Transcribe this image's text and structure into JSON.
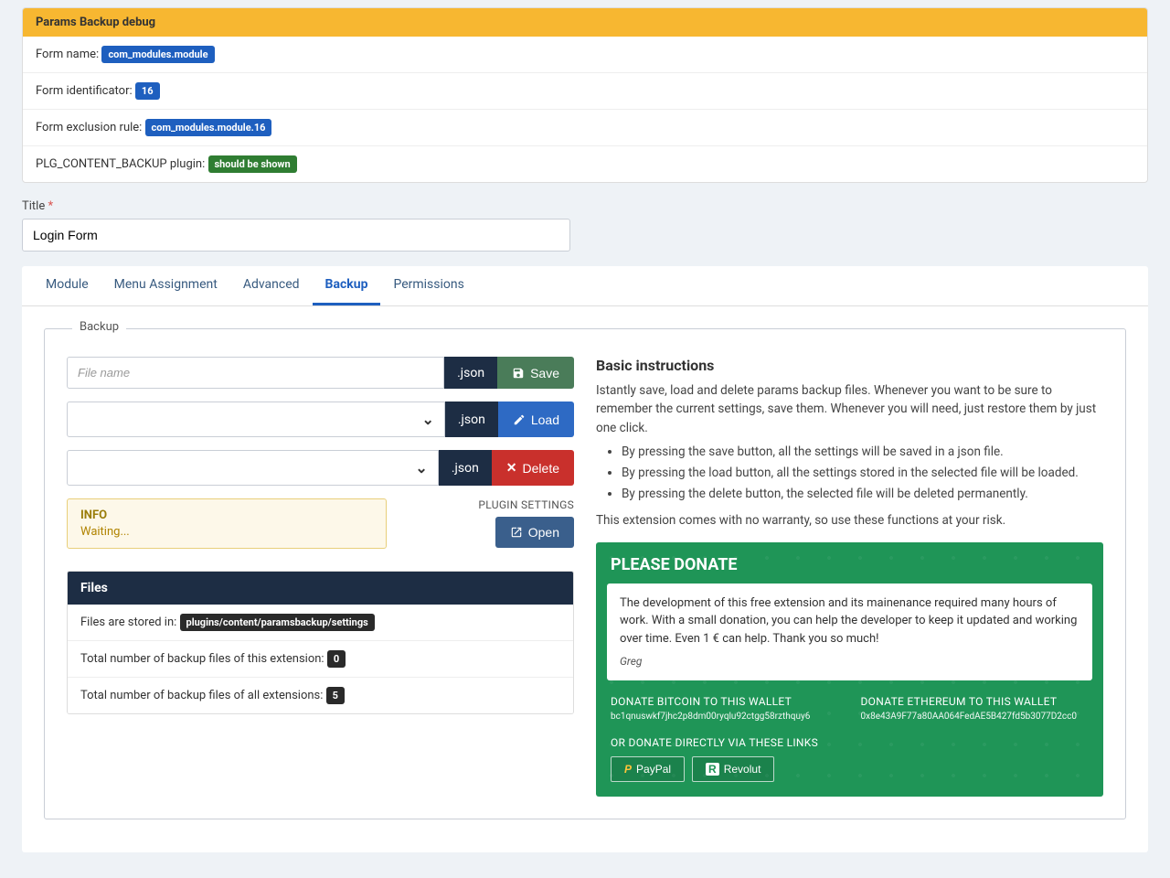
{
  "debug": {
    "header": "Params Backup debug",
    "form_name_label": "Form name:",
    "form_name_value": "com_modules.module",
    "form_id_label": "Form identificator:",
    "form_id_value": "16",
    "exclusion_label": "Form exclusion rule:",
    "exclusion_value": "com_modules.module.16",
    "plugin_label": "PLG_CONTENT_BACKUP plugin:",
    "plugin_value": "should be shown"
  },
  "title": {
    "label": "Title",
    "required": "*",
    "value": "Login Form"
  },
  "tabs": {
    "module": "Module",
    "menu": "Menu Assignment",
    "advanced": "Advanced",
    "backup": "Backup",
    "permissions": "Permissions"
  },
  "backup": {
    "legend": "Backup",
    "filename_placeholder": "File name",
    "ext": ".json",
    "save": "Save",
    "load": "Load",
    "delete": "Delete",
    "info_title": "INFO",
    "info_msg": "Waiting...",
    "settings_label": "PLUGIN SETTINGS",
    "open": "Open",
    "files_header": "Files",
    "files_stored_label": "Files are stored in:",
    "files_stored_path": "plugins/content/paramsbackup/settings",
    "files_this_label": "Total number of backup files of this extension:",
    "files_this_count": "0",
    "files_all_label": "Total number of backup files of all extensions:",
    "files_all_count": "5"
  },
  "instructions": {
    "heading": "Basic instructions",
    "p1": "Istantly save, load and delete params backup files. Whenever you want to be sure to remember the current settings, save them. Whenever you will need, just restore them by just one click.",
    "li1": "By pressing the save button, all the settings will be saved in a json file.",
    "li2": "By pressing the load button, all the settings stored in the selected file will be loaded.",
    "li3": "By pressing the delete button, the selected file will be deleted permanently.",
    "p2": "This extension comes with no warranty, so use these functions at your risk."
  },
  "donate": {
    "title": "PLEASE DONATE",
    "body": "The development of this free extension and its mainenance required many hours of work. With a small donation, you can help the developer to keep it updated and working over time. Even 1 € can help. Thank you so much!",
    "signature": "Greg",
    "btc_title": "DONATE BITCOIN TO THIS WALLET",
    "btc_addr": "bc1qnuswkf7jhc2p8dm00ryqlu92ctgg58rzthquy6",
    "eth_title": "DONATE ETHEREUM TO THIS WALLET",
    "eth_addr": "0x8e43A9F77a80AA064FedAE5B427fd5b3077D2cc0",
    "links_title": "OR DONATE DIRECTLY VIA THESE LINKS",
    "paypal": "PayPal",
    "revolut": "Revolut"
  }
}
